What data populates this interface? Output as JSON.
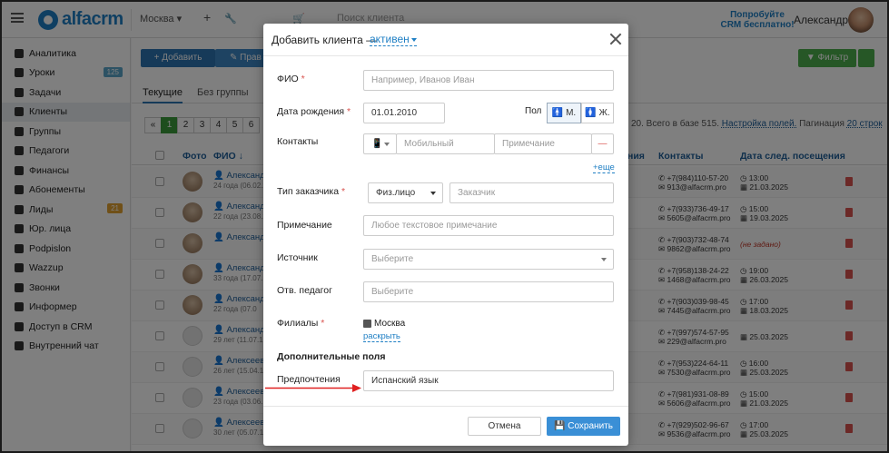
{
  "brand": {
    "name": "alfacrm"
  },
  "topbar": {
    "city": "Москва ▾",
    "search_placeholder": "Поиск клиента",
    "promo_line1": "Попробуйте",
    "promo_line2": "CRM бесплатно!",
    "user_name": "Александра",
    "icons": [
      "menu-icon",
      "plus-icon",
      "wrench-icon",
      "mail-icon",
      "document-icon",
      "cart-icon"
    ]
  },
  "sidebar": {
    "items": [
      {
        "label": "Аналитика",
        "icon": "chart-icon"
      },
      {
        "label": "Уроки",
        "icon": "book-icon",
        "badge": "125",
        "badge_color": "#5aa5c9"
      },
      {
        "label": "Задачи",
        "icon": "task-icon"
      },
      {
        "label": "Клиенты",
        "icon": "user-icon",
        "active": true
      },
      {
        "label": "Группы",
        "icon": "group-icon"
      },
      {
        "label": "Педагоги",
        "icon": "graduation-icon"
      },
      {
        "label": "Финансы",
        "icon": "money-icon"
      },
      {
        "label": "Абонементы",
        "icon": "tag-icon"
      },
      {
        "label": "Лиды",
        "icon": "lead-icon",
        "badge": "21",
        "badge_color": "#e0a030"
      },
      {
        "label": "Юр. лица",
        "icon": "briefcase-icon"
      },
      {
        "label": "Podpislon",
        "icon": "file-icon"
      },
      {
        "label": "Wazzup",
        "icon": "chat-icon"
      },
      {
        "label": "Звонки",
        "icon": "phone-icon"
      },
      {
        "label": "Информер",
        "icon": "inbox-icon"
      },
      {
        "label": "Доступ в CRM",
        "icon": "lock-icon"
      },
      {
        "label": "Внутренний чат",
        "icon": "message-icon"
      }
    ]
  },
  "main": {
    "add_button": "+ Добавить",
    "edit_button": "✎ Прав",
    "filter_button": "▼ Фильтр",
    "tabs": [
      {
        "label": "Текущие",
        "active": true
      },
      {
        "label": "Без группы"
      }
    ],
    "pager": [
      "«",
      "1",
      "2",
      "3",
      "4",
      "5",
      "6"
    ],
    "meta_text": "20. Всего в базе 515.",
    "meta_link": "Настройка полей.",
    "meta_pag_label": "Пагинация",
    "meta_pag_value": "20 строк",
    "columns": {
      "photo": "Фото",
      "name": "ФИО ↓",
      "hidden": "ния",
      "contacts": "Контакты",
      "next_visit": "Дата след. посещения"
    },
    "rows": [
      {
        "name": "Александр",
        "sub": "24 года (06.02.2",
        "phone": "+7(984)110-57-20",
        "email": "913@alfacrm.pro",
        "time": "13:00",
        "date": "21.03.2025",
        "photo": true
      },
      {
        "name": "Александр",
        "sub": "22 года (23.08.2",
        "phone": "+7(933)736-49-17",
        "email": "5605@alfacrm.pro",
        "time": "15:00",
        "date": "19.03.2025",
        "photo": true
      },
      {
        "name": "Александр",
        "sub": "",
        "phone": "+7(903)732-48-74",
        "email": "9862@alfacrm.pro",
        "time": "",
        "date": "(не задано)",
        "photo": true
      },
      {
        "name": "Александр",
        "sub": "33 года (17.07.1",
        "phone": "+7(958)138-24-22",
        "email": "1468@alfacrm.pro",
        "time": "19:00",
        "date": "26.03.2025",
        "photo": true
      },
      {
        "name": "Александр",
        "sub": "22 года (07.0",
        "phone": "+7(903)039-98-45",
        "email": "7445@alfacrm.pro",
        "time": "17:00",
        "date": "18.03.2025",
        "photo": true
      },
      {
        "name": "Александр",
        "sub": "29 лет (11.07.19",
        "phone": "+7(997)574-57-95",
        "email": "229@alfacrm.pro",
        "time": "",
        "date": "25.03.2025",
        "photo": false
      },
      {
        "name": "Алексеев В",
        "sub": "26 лет (15.04.19",
        "phone": "+7(953)224-64-11",
        "email": "7530@alfacrm.pro",
        "time": "16:00",
        "date": "25.03.2025",
        "photo": false
      },
      {
        "name": "Алексеев К",
        "sub": "23 года (03.06.1",
        "phone": "+7(981)931-08-89",
        "email": "5606@alfacrm.pro",
        "time": "15:00",
        "date": "21.03.2025",
        "photo": false
      },
      {
        "name": "Алексеев К",
        "sub": "30 лет (05.07.19",
        "phone": "+7(929)502-96-67",
        "email": "9536@alfacrm.pro",
        "time": "17:00",
        "date": "25.03.2025",
        "photo": false
      }
    ]
  },
  "modal": {
    "title": "Добавить клиента —",
    "status": "активен",
    "fields": {
      "fio_label": "ФИО",
      "fio_placeholder": "Например, Иванов Иван",
      "birth_label": "Дата рождения",
      "birth_value": "01.01.2010",
      "gender_label": "Пол",
      "gender_m": "М.",
      "gender_f": "Ж.",
      "contacts_label": "Контакты",
      "phone_placeholder": "Мобильный",
      "note_placeholder": "Примечание",
      "more_link": "+еще",
      "customer_type_label": "Тип заказчика",
      "customer_type_value": "Физ.лицо",
      "customer_placeholder": "Заказчик",
      "remark_label": "Примечание",
      "remark_placeholder": "Любое текстовое примечание",
      "source_label": "Источник",
      "source_placeholder": "Выберите",
      "teacher_label": "Отв. педагог",
      "teacher_placeholder": "Выберите",
      "branches_label": "Филиалы",
      "branch_value": "Москва",
      "expand_link": "раскрыть",
      "extra_section": "Дополнительные поля",
      "pref_label": "Предпочтения",
      "pref_value": "Испанский язык",
      "required_mark": "*"
    },
    "cancel_button": "Отмена",
    "save_button": "Сохранить",
    "arrow_color": "#e02020"
  }
}
